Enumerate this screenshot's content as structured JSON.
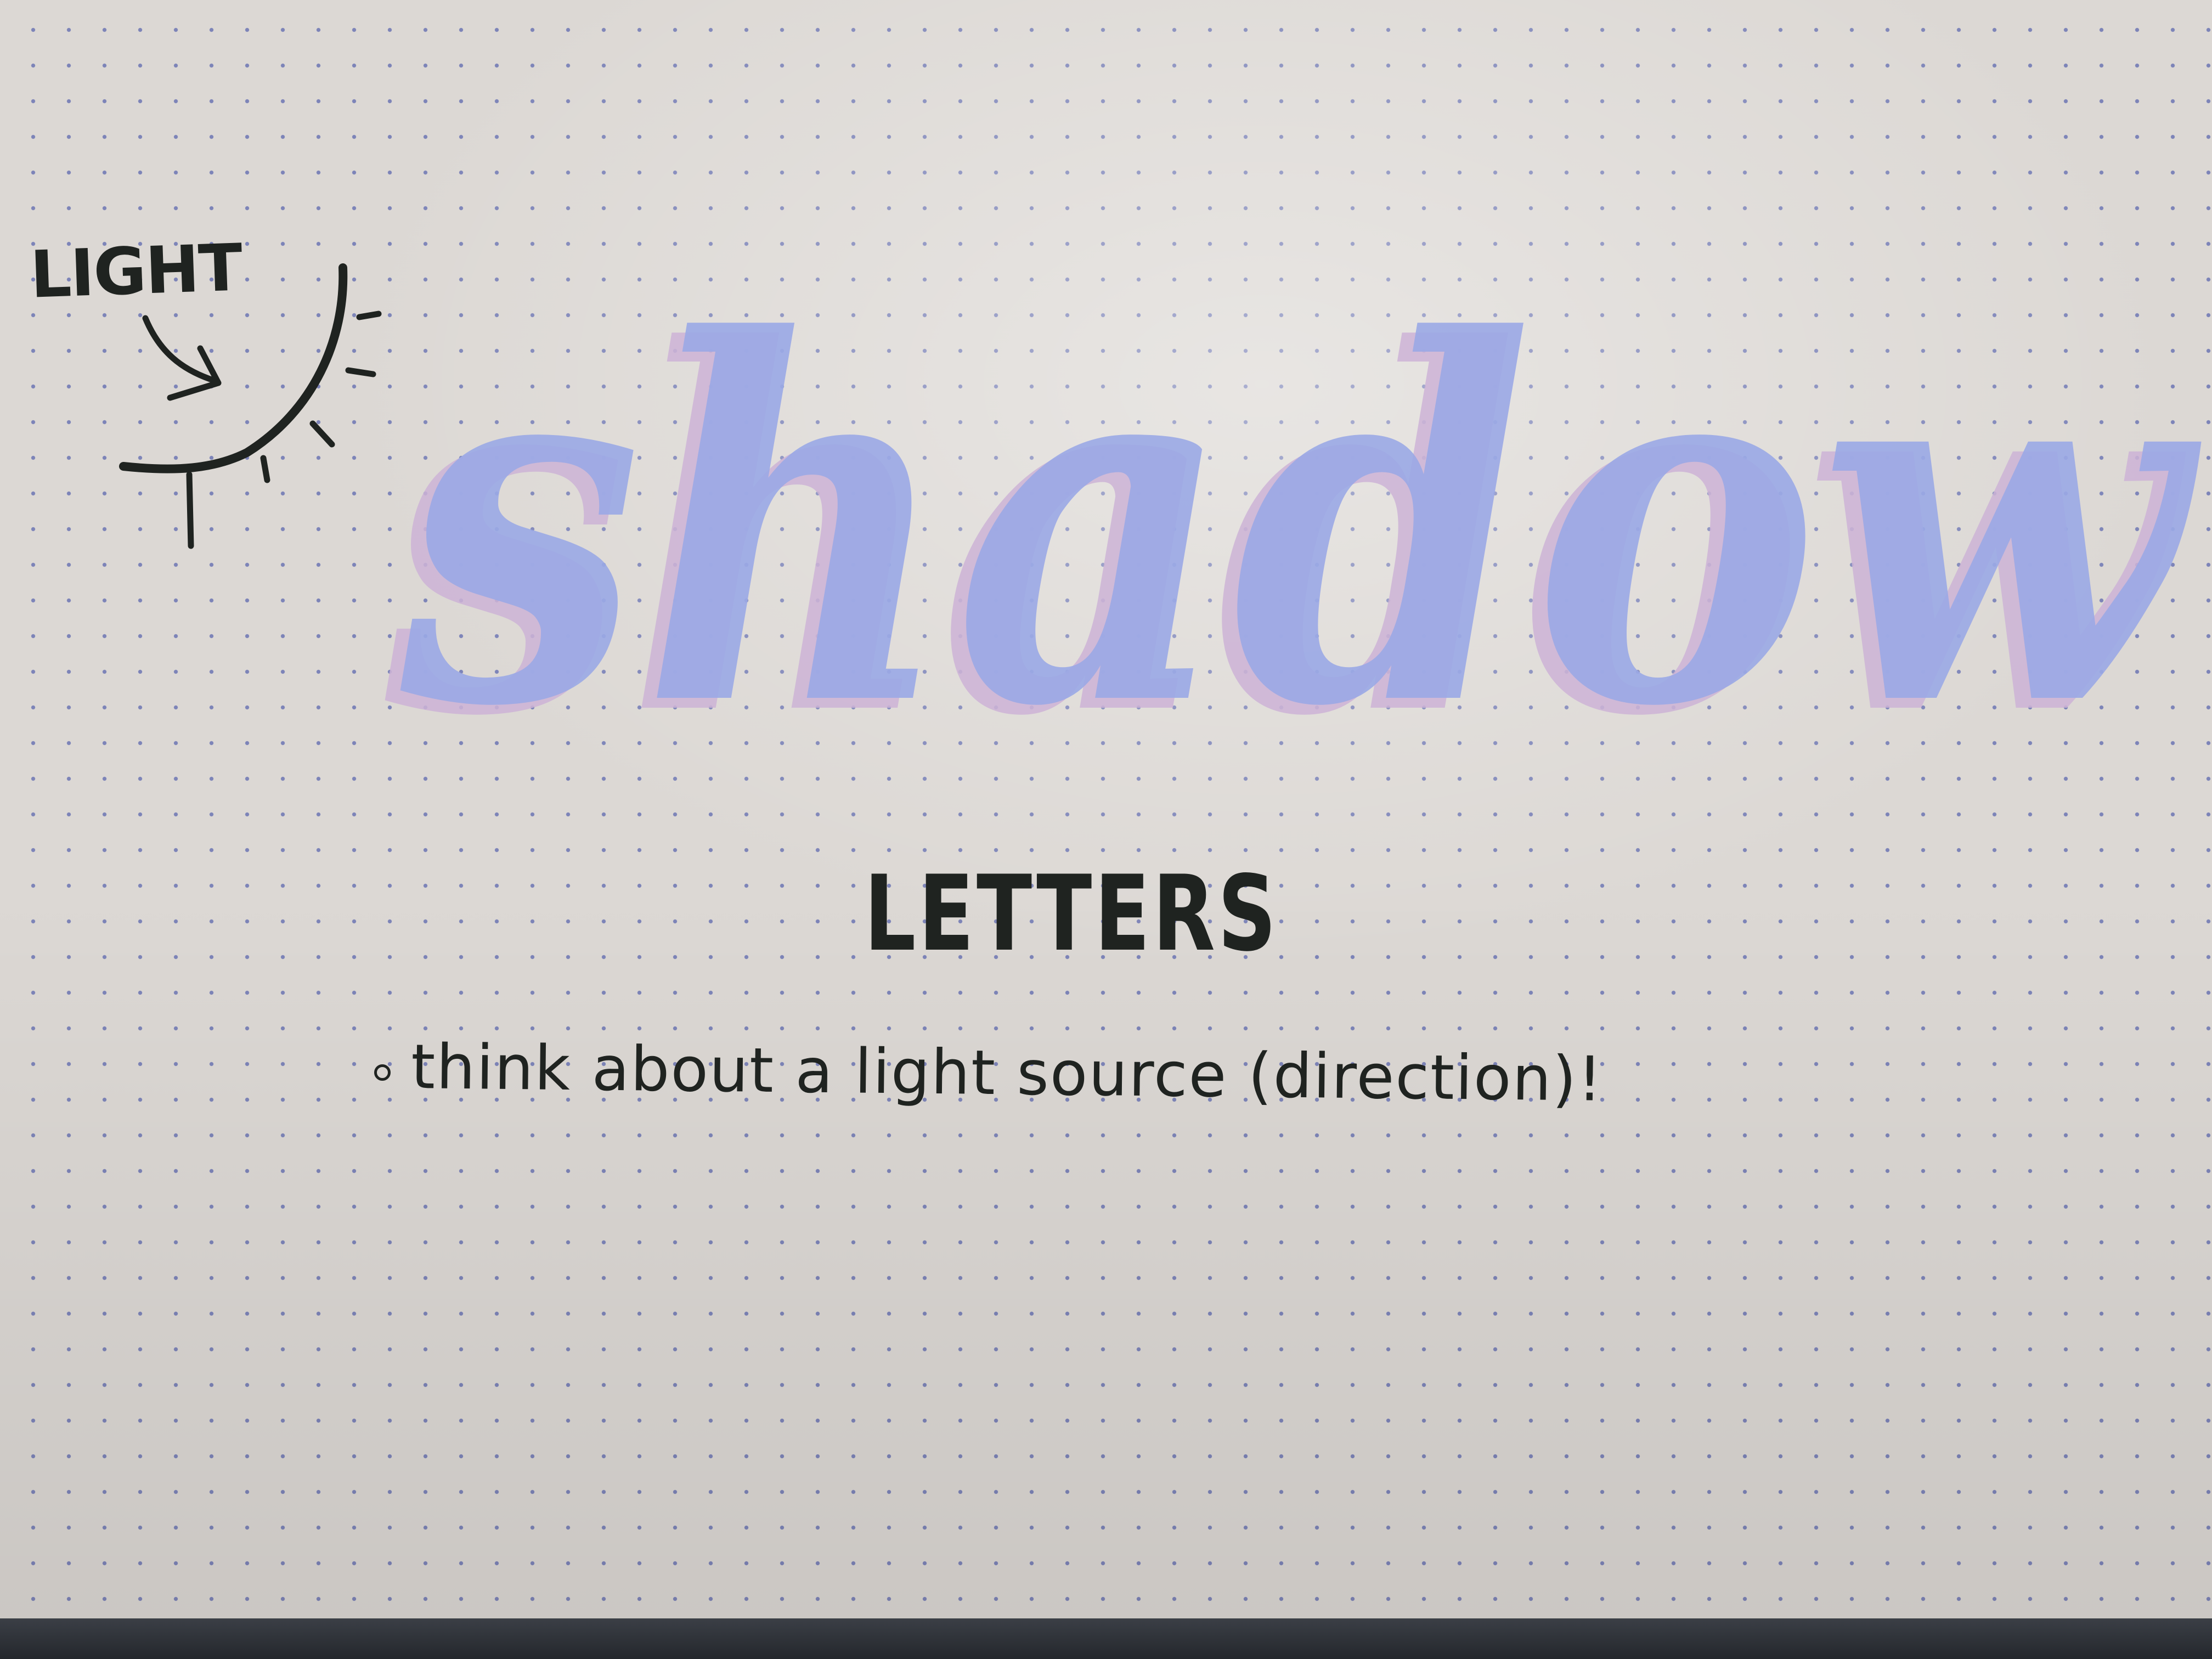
{
  "notebook": {
    "light_label": "LIGHT",
    "title_script": "shadow",
    "heading": "LETTERS",
    "tip": "think about a light source (direction)!"
  },
  "icons": {
    "arrow": "curved-arrow-icon",
    "sun": "sun-rays-icon"
  },
  "colors": {
    "paper": "#dcd8d4",
    "dot_grid": "#7d84b8",
    "ink": "#1f2320",
    "letter_blue": "#9aa8e6",
    "shadow_pink": "#cdb3d6"
  }
}
